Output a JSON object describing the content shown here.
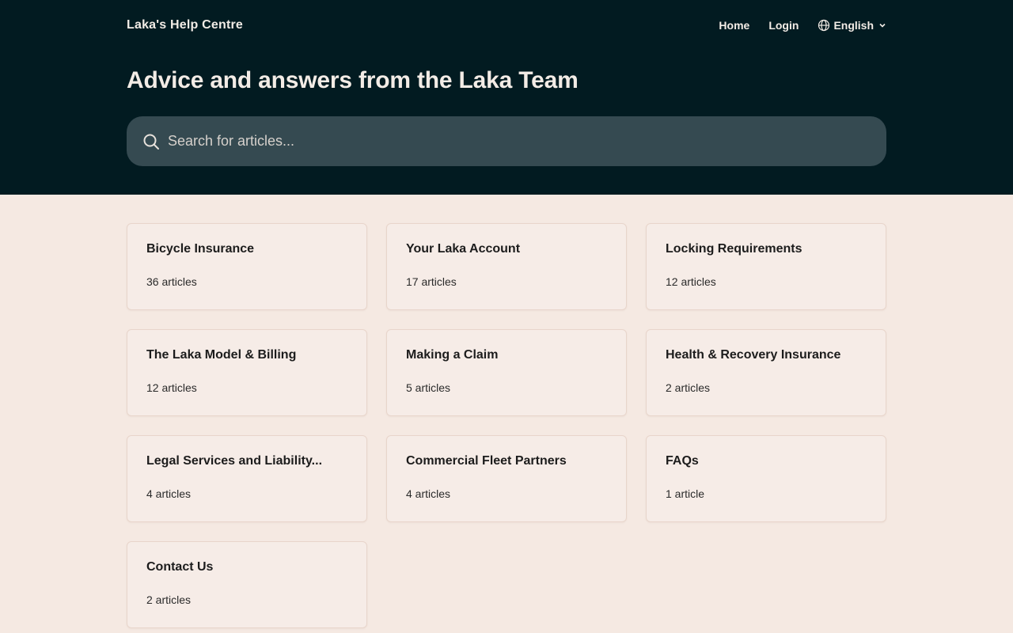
{
  "header": {
    "brand": "Laka's Help Centre",
    "nav": {
      "home": "Home",
      "login": "Login",
      "language": "English"
    },
    "title": "Advice and answers from the Laka Team",
    "search": {
      "placeholder": "Search for articles..."
    }
  },
  "collections": [
    {
      "title": "Bicycle Insurance",
      "count": "36 articles"
    },
    {
      "title": "Your Laka Account",
      "count": "17 articles"
    },
    {
      "title": "Locking Requirements",
      "count": "12 articles"
    },
    {
      "title": "The Laka Model & Billing",
      "count": "12 articles"
    },
    {
      "title": "Making a Claim",
      "count": "5 articles"
    },
    {
      "title": "Health & Recovery Insurance",
      "count": "2 articles"
    },
    {
      "title": "Legal Services and Liability...",
      "count": "4 articles"
    },
    {
      "title": "Commercial Fleet Partners",
      "count": "4 articles"
    },
    {
      "title": "FAQs",
      "count": "1 article"
    },
    {
      "title": "Contact Us",
      "count": "2 articles"
    }
  ],
  "colors": {
    "header_bg": "#021b21",
    "search_bg": "#354a51",
    "page_bg": "#f5e9e2",
    "card_bg": "#f6ece7",
    "card_border": "#e8d5cb"
  },
  "icons": {
    "search": "search-icon",
    "language": "globe-icon",
    "dropdown": "chevron-down-icon"
  }
}
